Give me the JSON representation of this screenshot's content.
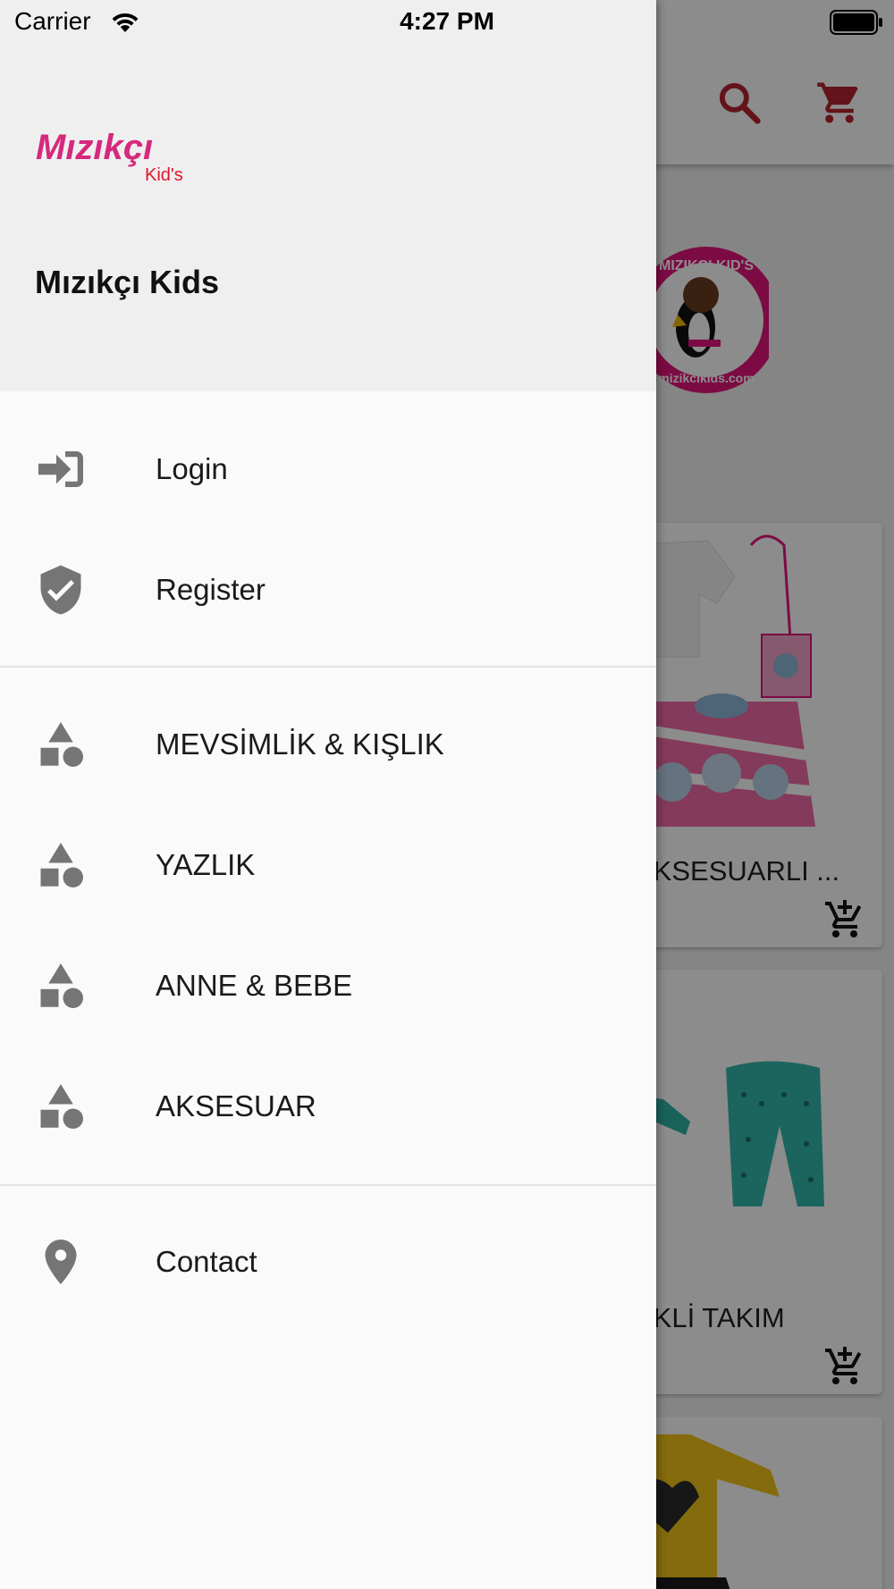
{
  "status_bar": {
    "carrier": "Carrier",
    "time": "4:27 PM"
  },
  "drawer": {
    "logo": {
      "word": "Mızıkçı",
      "sub": "Kid's"
    },
    "store_name": "Mızıkçı Kids",
    "account_items": [
      {
        "label": "Login",
        "icon": "login-icon"
      },
      {
        "label": "Register",
        "icon": "verified-shield-icon"
      }
    ],
    "category_items": [
      {
        "label": "MEVSİMLİK & KIŞLIK",
        "icon": "category-shapes-icon"
      },
      {
        "label": "YAZLIK",
        "icon": "category-shapes-icon"
      },
      {
        "label": "ANNE & BEBE",
        "icon": "category-shapes-icon"
      },
      {
        "label": "AKSESUAR",
        "icon": "category-shapes-icon"
      }
    ],
    "contact_item": {
      "label": "Contact",
      "icon": "location-pin-icon"
    }
  },
  "background": {
    "toolbar_icons": [
      "search-icon",
      "cart-icon"
    ],
    "store_badge": {
      "top": "MIZIKÇI KID'S",
      "bottom": "mizikcikids.com"
    },
    "products": [
      {
        "title": "AKSESUARLI ..."
      },
      {
        "title": "EKLİ TAKIM"
      }
    ]
  },
  "colors": {
    "accent": "#b4232f",
    "drawer_bg": "#fafafa",
    "header_bg": "#efefef",
    "icon_gray": "#757575"
  }
}
